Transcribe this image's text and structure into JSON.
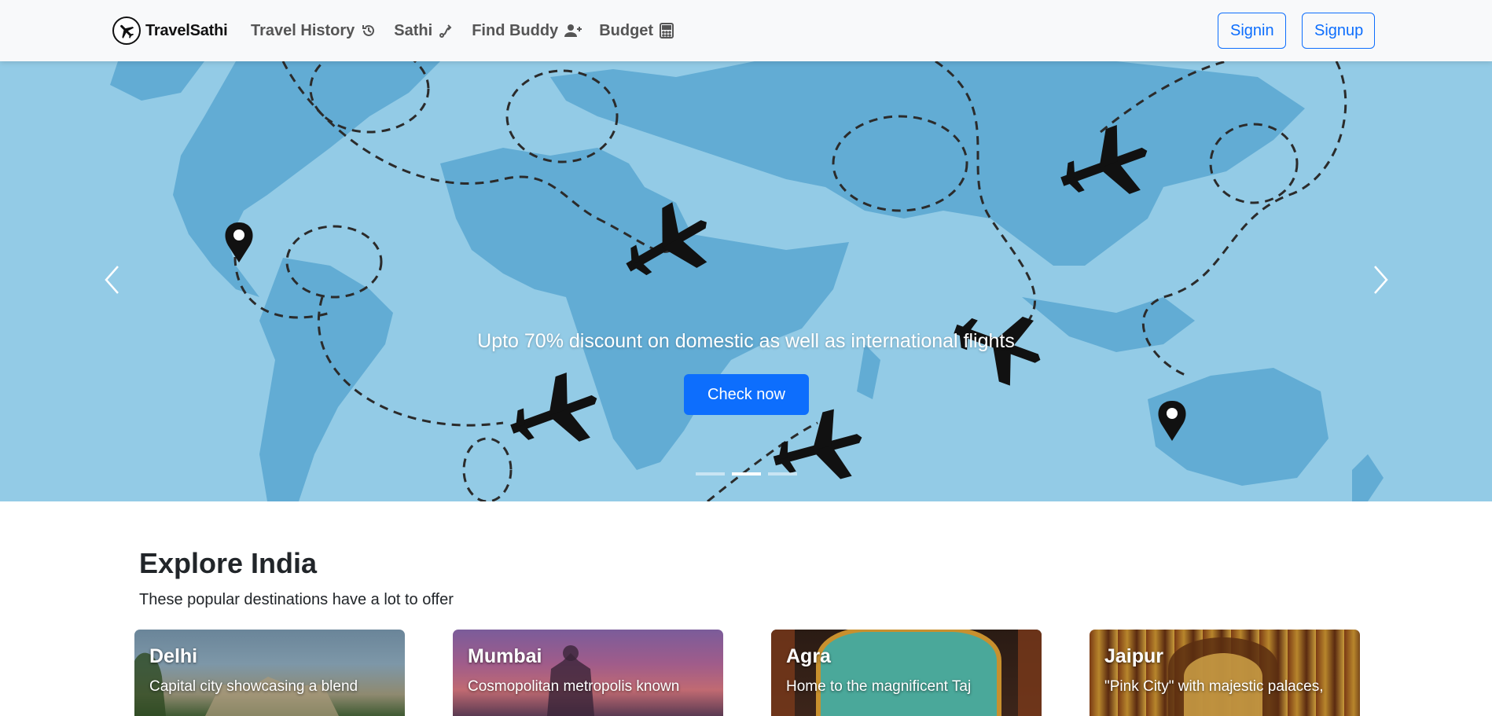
{
  "brand": {
    "name": "TravelSathi",
    "logo_icon": "airplane-logo-icon"
  },
  "nav": {
    "links": [
      {
        "label": "Travel History",
        "icon": "history-icon"
      },
      {
        "label": "Sathi",
        "icon": "route-icon"
      },
      {
        "label": "Find Buddy",
        "icon": "user-plus-icon"
      },
      {
        "label": "Budget",
        "icon": "calculator-icon"
      }
    ],
    "signin_label": "Signin",
    "signup_label": "Signup"
  },
  "hero": {
    "caption": "Upto 70% discount on domestic as well as international flights",
    "cta_label": "Check now",
    "slide_count": 3,
    "active_slide": 2
  },
  "explore": {
    "title": "Explore India",
    "subtitle": "These popular destinations have a lot to offer",
    "cards": [
      {
        "title": "Delhi",
        "desc": "Capital city showcasing a blend"
      },
      {
        "title": "Mumbai",
        "desc": "Cosmopolitan metropolis known"
      },
      {
        "title": "Agra",
        "desc": "Home to the magnificent Taj"
      },
      {
        "title": "Jaipur",
        "desc": "\"Pink City\" with majestic palaces,"
      }
    ]
  },
  "colors": {
    "primary": "#0d6efd",
    "navbar_bg": "#f8f9fa",
    "ocean": "#93cbe6",
    "land": "#62acd4"
  }
}
